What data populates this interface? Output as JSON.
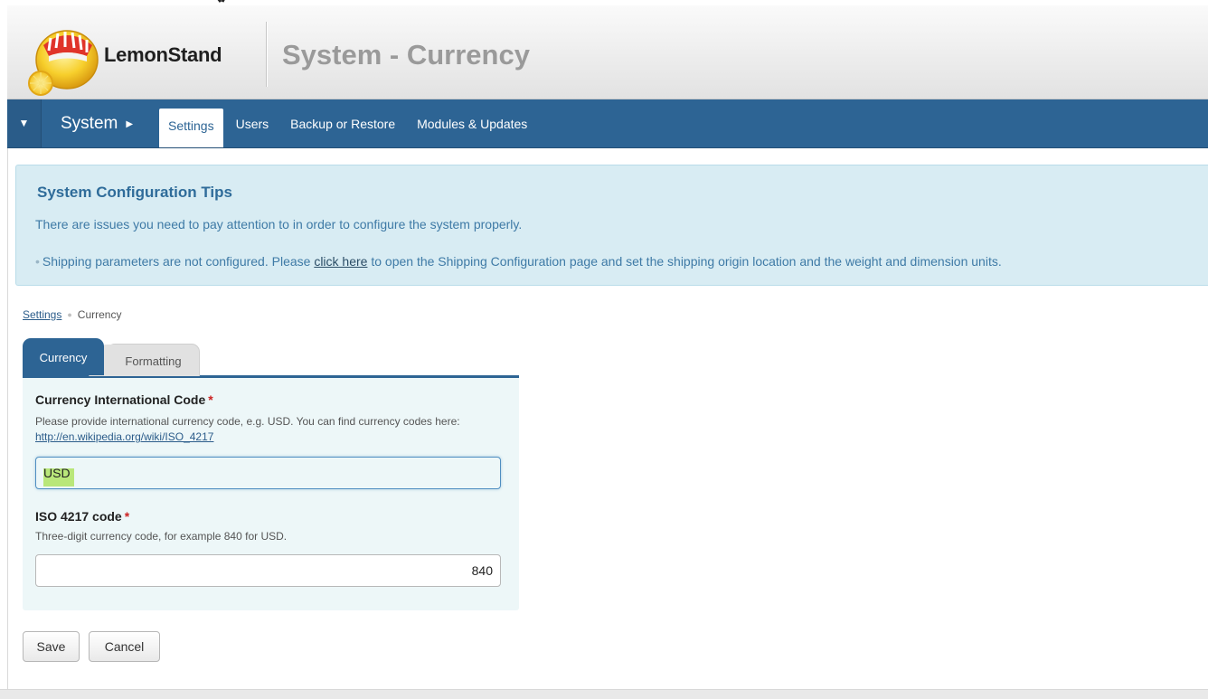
{
  "header": {
    "brand": "LemonStand",
    "title": "System - Currency"
  },
  "nav": {
    "toggle_icon": "triangle-down",
    "section": "System",
    "section_arrow": "▶",
    "items": [
      {
        "label": "Settings",
        "active": true
      },
      {
        "label": "Users",
        "active": false
      },
      {
        "label": "Backup or Restore",
        "active": false
      },
      {
        "label": "Modules & Updates",
        "active": false
      }
    ]
  },
  "tips": {
    "title": "System Configuration Tips",
    "text": "There are issues you need to pay attention to in order to configure the system properly.",
    "bullet_before": "Shipping parameters are not configured. Please ",
    "bullet_link": "click here",
    "bullet_after": " to open the Shipping Configuration page and set the shipping origin location and the weight and dimension units."
  },
  "breadcrumb": {
    "parent": "Settings",
    "current": "Currency"
  },
  "tabs": {
    "active": "Currency",
    "inactive": "Formatting"
  },
  "form": {
    "code_label": "Currency International Code",
    "code_help": "Please provide international currency code, e.g. USD. You can find currency codes here: ",
    "code_help_link": "http://en.wikipedia.org/wiki/ISO_4217",
    "code_value": "USD",
    "iso_label": "ISO 4217 code",
    "iso_help": "Three-digit currency code, for example 840 for USD.",
    "iso_value": "840",
    "required_mark": "*"
  },
  "buttons": {
    "save": "Save",
    "cancel": "Cancel"
  },
  "colors": {
    "nav_bg": "#2d6494",
    "tips_bg": "#d8ecf3",
    "form_bg": "#edf7f8",
    "required": "#cc2222",
    "selection": "#b9e77a"
  }
}
